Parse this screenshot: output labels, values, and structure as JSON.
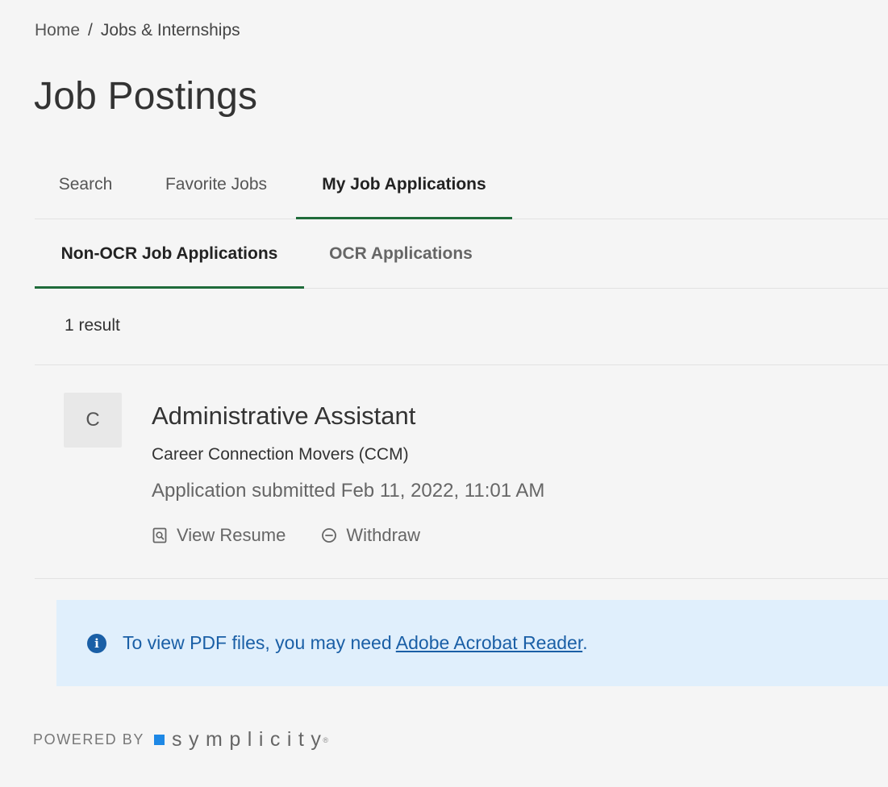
{
  "breadcrumb": {
    "home": "Home",
    "separator": "/",
    "current": "Jobs & Internships"
  },
  "page_title": "Job Postings",
  "primary_tabs": [
    {
      "label": "Search",
      "active": false
    },
    {
      "label": "Favorite Jobs",
      "active": false
    },
    {
      "label": "My Job Applications",
      "active": true
    }
  ],
  "secondary_tabs": [
    {
      "label": "Non-OCR Job Applications",
      "active": true
    },
    {
      "label": "OCR Applications",
      "active": false
    }
  ],
  "result_count": "1 result",
  "application": {
    "avatar_letter": "C",
    "job_title": "Administrative Assistant",
    "employer": "Career Connection Movers (CCM)",
    "submitted": "Application submitted Feb 11, 2022, 11:01 AM",
    "actions": {
      "view_resume": "View Resume",
      "withdraw": "Withdraw"
    }
  },
  "info": {
    "text_before": "To view PDF files, you may need ",
    "link": "Adobe Acrobat Reader",
    "text_after": "."
  },
  "footer": {
    "powered_by": "POWERED BY",
    "brand": "symplicity",
    "trademark": "®"
  },
  "colors": {
    "accent_green": "#1f6b3a",
    "info_blue": "#1a5fa6",
    "info_bg": "#e0effc",
    "brand_blue": "#1e88e5"
  },
  "icons": {
    "view_resume": "document-search-icon",
    "withdraw": "minus-circle-icon",
    "info": "info-circle-icon",
    "brand": "brand-square-icon"
  }
}
